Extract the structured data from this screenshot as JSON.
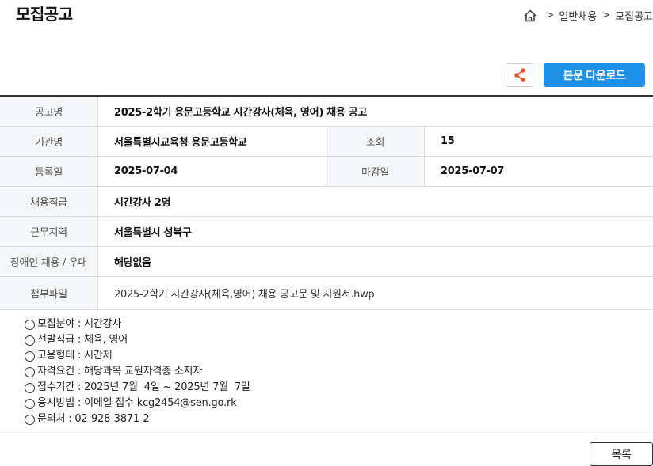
{
  "page": {
    "title": "모집공고"
  },
  "breadcrumb": {
    "items": [
      "일반채용",
      "모집공고"
    ],
    "separator": ">"
  },
  "toolbar": {
    "download_label": "본문 다운로드"
  },
  "colors": {
    "accent": "#1e90e8",
    "share_icon": "#e8542b"
  },
  "info": {
    "title_label": "공고명",
    "title_value": "2025-2학기 용문고등학교 시간강사(체육, 영어) 채용 공고",
    "org_label": "기관명",
    "org_value": "서울특별시교육청 용문고등학교",
    "views_label": "조회",
    "views_value": "15",
    "reg_label": "등록일",
    "reg_value": "2025-07-04",
    "deadline_label": "마감일",
    "deadline_value": "2025-07-07",
    "position_label": "채용직급",
    "position_value": "시간강사 2명",
    "region_label": "근무지역",
    "region_value": "서울특별시 성북구",
    "disability_label": "장애인 채용 / 우대",
    "disability_value": "해당없음",
    "attachment_label": "첨부파일",
    "attachment_value": "2025-2학기 시간강사(체육,영어) 채용 공고문 및 지원서.hwp"
  },
  "details": [
    "모집분야 : 시간강사",
    "선발직급 : 체육, 영어",
    "고용형태 : 시간제",
    "자격요건 : 해당과목 교원자격증 소지자",
    "접수기간 : 2025년 7월  4일 ~ 2025년 7월  7일",
    "응시방법 : 이메일 접수 kcg2454@sen.go.rk",
    "문의처 : 02-928-3871-2"
  ],
  "footer": {
    "list_label": "목록"
  }
}
